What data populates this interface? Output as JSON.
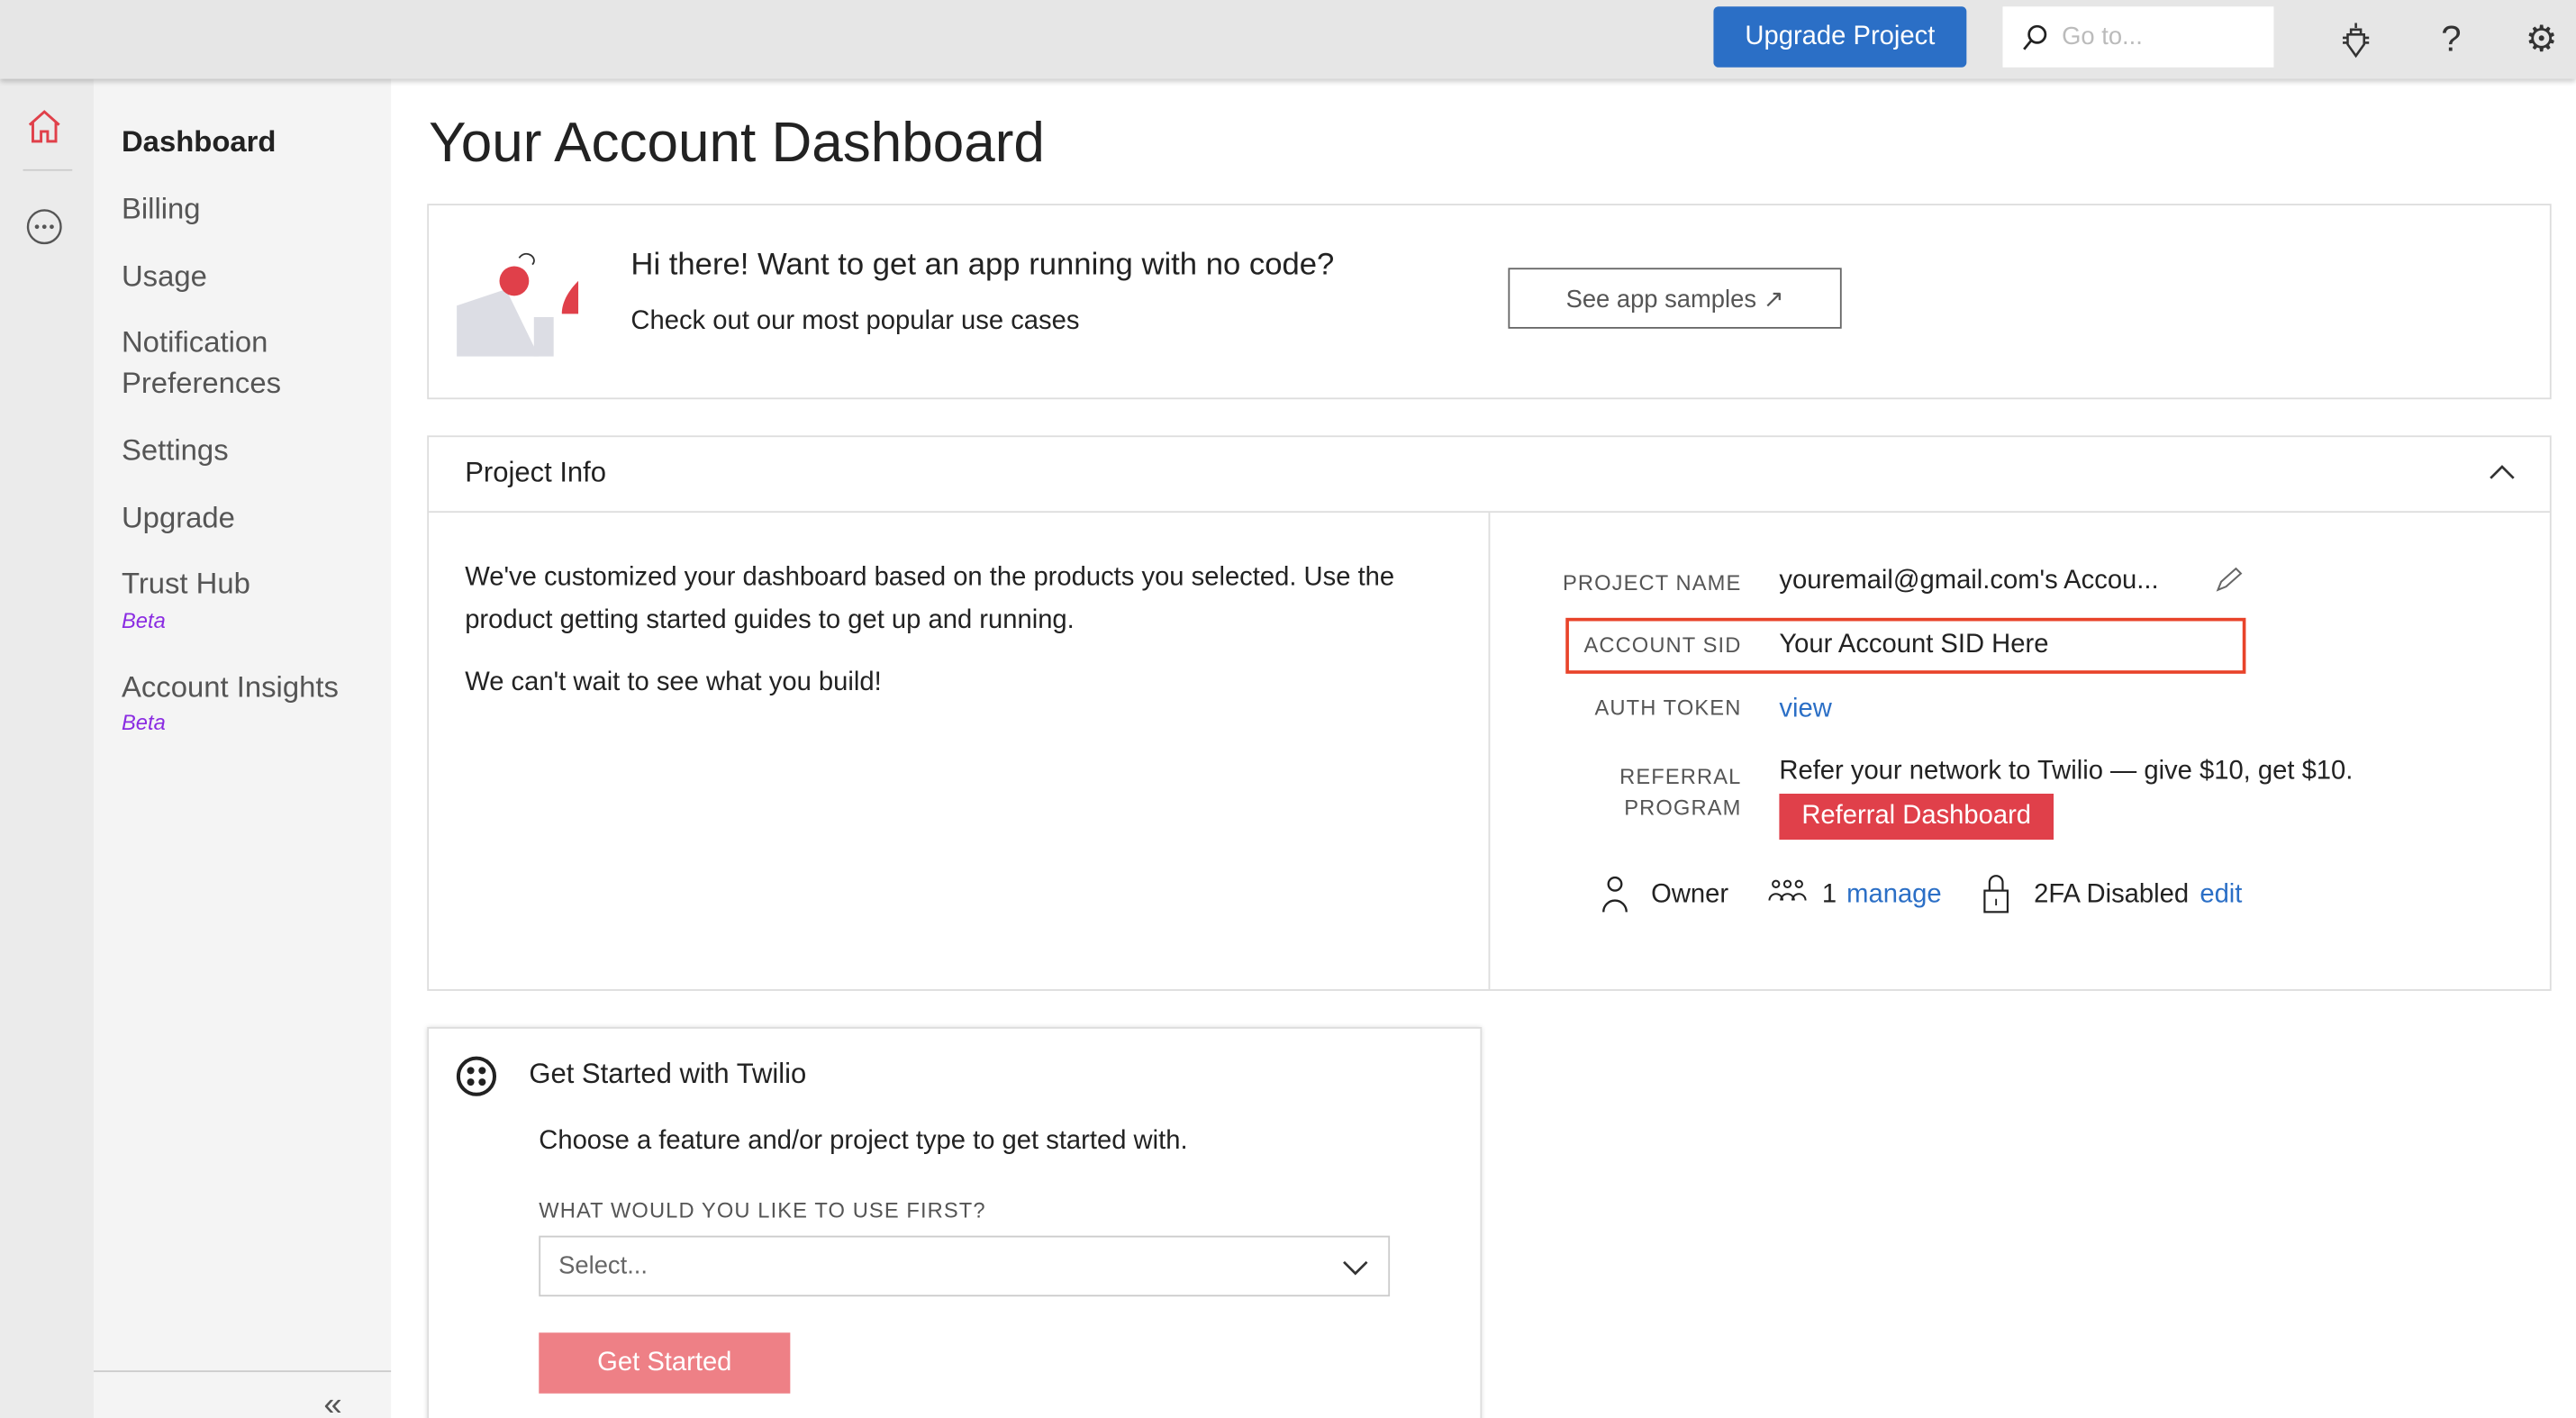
{
  "topbar": {
    "upgrade_label": "Upgrade Project",
    "search_placeholder": "Go to...",
    "icons": [
      "bug-icon",
      "help-icon",
      "gear-icon"
    ]
  },
  "rail": {
    "icons": [
      "home-icon",
      "more-icon"
    ]
  },
  "sidebar": {
    "items": [
      {
        "label": "Dashboard"
      },
      {
        "label": "Billing"
      },
      {
        "label": "Usage"
      },
      {
        "label": "Notification Preferences"
      },
      {
        "label": "Settings"
      },
      {
        "label": "Upgrade"
      },
      {
        "label": "Trust Hub",
        "badge": "Beta"
      },
      {
        "label": "Account Insights",
        "badge": "Beta"
      }
    ],
    "collapse": "«"
  },
  "page": {
    "title": "Your Account Dashboard"
  },
  "banner": {
    "heading": "Hi there! Want to get an app running with no code?",
    "sub": "Check out our most popular use cases",
    "button": "See app samples ↗"
  },
  "project_info": {
    "title": "Project Info",
    "desc1": "We've customized your dashboard based on the products you selected. Use the product getting started guides to get up and running.",
    "desc2": "We can't wait to see what you build!",
    "project_name_label": "PROJECT NAME",
    "project_name": "youremail@gmail.com's Accou...",
    "account_sid_label": "ACCOUNT SID",
    "account_sid": "Your Account SID Here",
    "auth_token_label": "AUTH TOKEN",
    "auth_token_link": "view",
    "referral_label_1": "REFERRAL",
    "referral_label_2": "PROGRAM",
    "referral_text": "Refer your network to Twilio — give $10, get $10.",
    "referral_button": "Referral Dashboard",
    "role": "Owner",
    "members_count": "1",
    "members_link": "manage",
    "twofa": "2FA Disabled",
    "twofa_link": "edit"
  },
  "get_started": {
    "title": "Get Started with Twilio",
    "desc": "Choose a feature and/or project type to get started with.",
    "select_label": "WHAT WOULD YOU LIKE TO USE FIRST?",
    "select_value": "Select...",
    "button": "Get Started"
  },
  "colors": {
    "accent": "#2b6fc6",
    "brand_red": "#e0404a",
    "highlight": "#e8432a"
  }
}
